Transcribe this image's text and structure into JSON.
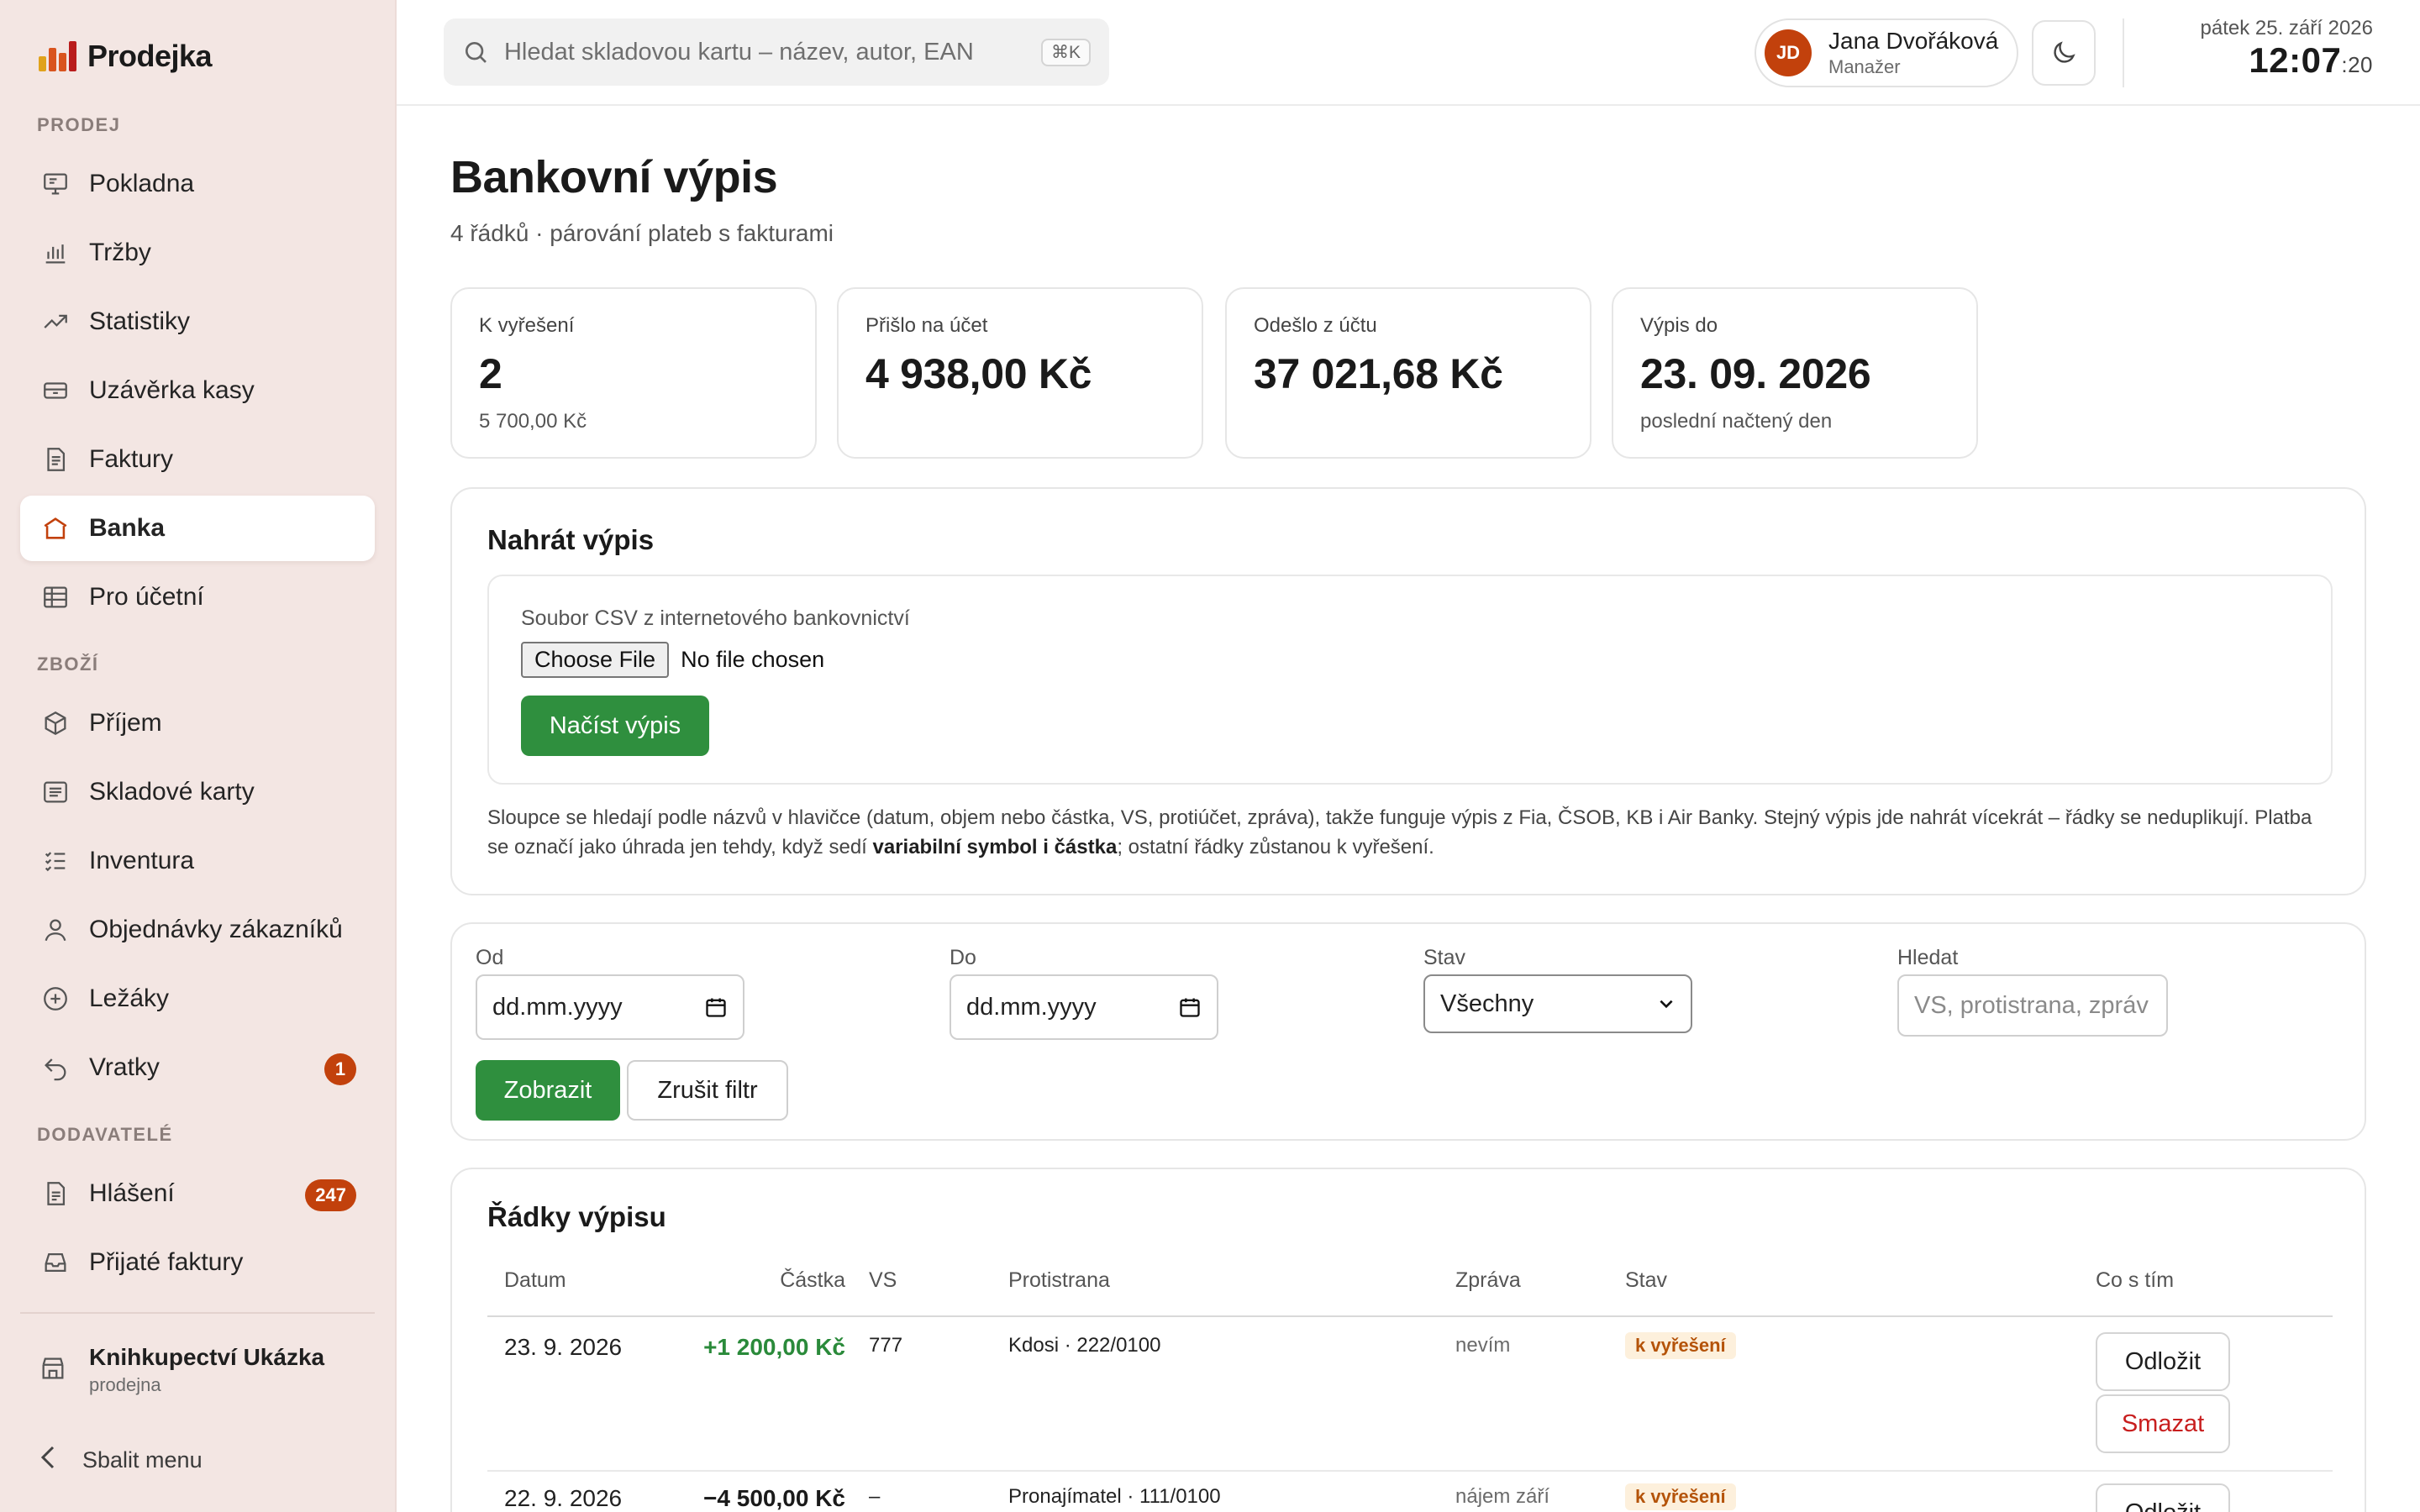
{
  "brand": {
    "name": "Prodejka",
    "logo_colors": [
      "#e0a21b",
      "#d9541e",
      "#b91c1c"
    ]
  },
  "sidebar": {
    "sections": [
      {
        "title": "PRODEJ"
      },
      {
        "title": "ZBOŽÍ"
      },
      {
        "title": "DODAVATELÉ"
      }
    ],
    "items": [
      {
        "label": "Pokladna",
        "icon": "monitor-icon"
      },
      {
        "label": "Tržby",
        "icon": "bar-chart-icon"
      },
      {
        "label": "Statistiky",
        "icon": "trend-icon"
      },
      {
        "label": "Uzávěrka kasy",
        "icon": "cash-drawer-icon"
      },
      {
        "label": "Faktury",
        "icon": "document-icon"
      },
      {
        "label": "Banka",
        "icon": "bank-icon",
        "active": true
      },
      {
        "label": "Pro účetní",
        "icon": "table-icon"
      },
      {
        "label": "Příjem",
        "icon": "box-icon"
      },
      {
        "label": "Skladové karty",
        "icon": "list-card-icon"
      },
      {
        "label": "Inventura",
        "icon": "checklist-icon"
      },
      {
        "label": "Objednávky zákazníků",
        "icon": "user-icon"
      },
      {
        "label": "Ležáky",
        "icon": "plus-circle-icon"
      },
      {
        "label": "Vratky",
        "icon": "undo-icon",
        "badge": "1"
      },
      {
        "label": "Hlášení",
        "icon": "report-icon",
        "badge": "247"
      },
      {
        "label": "Přijaté faktury",
        "icon": "inbox-icon"
      }
    ],
    "store": {
      "name": "Knihkupectví Ukázka",
      "sub": "prodejna"
    },
    "collapse_label": "Sbalit menu",
    "accent": "#c2410c"
  },
  "header": {
    "search_placeholder": "Hledat skladovou kartu – název, autor, EAN",
    "search_shortcut": "⌘K",
    "user": {
      "initials": "JD",
      "name": "Jana Dvořáková",
      "role": "Manažer"
    },
    "date": "pátek 25. září 2026",
    "time_hm": "12:07",
    "time_s": ":20"
  },
  "page": {
    "title": "Bankovní výpis",
    "subtitle": "4 řádků · párování plateb s fakturami"
  },
  "stats": [
    {
      "label": "K vyřešení",
      "value": "2",
      "note": "5 700,00 Kč"
    },
    {
      "label": "Přišlo na účet",
      "value": "4 938,00 Kč",
      "note": ""
    },
    {
      "label": "Odešlo z účtu",
      "value": "37 021,68 Kč",
      "note": ""
    },
    {
      "label": "Výpis do",
      "value": "23. 09. 2026",
      "note": "poslední načtený den"
    }
  ],
  "upload": {
    "title": "Nahrát výpis",
    "file_label": "Soubor CSV z internetového bankovnictví",
    "choose_file": "Choose File",
    "no_file": "No file chosen",
    "submit": "Načíst výpis",
    "help_1": "Sloupce se hledají podle názvů v hlavičce (datum, objem nebo částka, VS, protiúčet, zpráva), takže funguje výpis z Fia, ČSOB, KB i Air Banky. Stejný výpis jde nahrát vícekrát – řádky se neduplikují. Platba se označí jako úhrada jen tehdy, když sedí ",
    "help_bold": "variabilní symbol i částka",
    "help_2": "; ostatní řádky zůstanou k vyřešení."
  },
  "filters": {
    "from_label": "Od",
    "from_value": "dd.mm.yyyy",
    "to_label": "Do",
    "to_value": "dd.mm.yyyy",
    "status_label": "Stav",
    "status_value": "Všechny",
    "search_label": "Hledat",
    "search_placeholder": "VS, protistrana, zpráv",
    "apply": "Zobrazit",
    "reset": "Zrušit filtr"
  },
  "table": {
    "title": "Řádky výpisu",
    "columns": [
      "Datum",
      "Částka",
      "VS",
      "Protistrana",
      "Zpráva",
      "Stav",
      "Co s tím"
    ],
    "rows": [
      {
        "date": "23. 9. 2026",
        "amount": "+1 200,00 Kč",
        "vs": "777",
        "party": "Kdosi · 222/0100",
        "message": "nevím",
        "status": "k vyřešení",
        "action_1": "Odložit",
        "action_2": "Smazat"
      },
      {
        "date": "22. 9. 2026",
        "amount": "−4 500,00 Kč",
        "vs": "–",
        "party": "Pronajímatel · 111/0100",
        "message": "nájem září",
        "status": "k vyřešení",
        "action_1": "Odložit"
      }
    ]
  },
  "colors": {
    "green": "#2f8f3e",
    "positive": "#2a8a3a",
    "warning_text": "#b45309",
    "warning_bg": "#fdf0dc",
    "danger": "#c81e1e"
  }
}
